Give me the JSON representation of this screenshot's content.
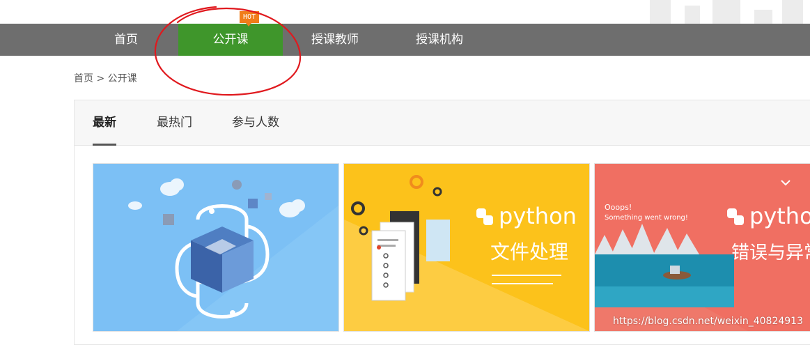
{
  "nav": {
    "items": [
      {
        "label": "首页"
      },
      {
        "label": "公开课"
      },
      {
        "label": "授课教师"
      },
      {
        "label": "授课机构"
      }
    ],
    "hot_badge": "HOT"
  },
  "breadcrumb": {
    "home": "首页",
    "separator": ">",
    "current": "公开课"
  },
  "tabs": [
    {
      "label": "最新"
    },
    {
      "label": "最热门"
    },
    {
      "label": "参与人数"
    }
  ],
  "cards": [
    {
      "theme": "python-logo"
    },
    {
      "python": "python",
      "subtitle": "文件处理"
    },
    {
      "python": "python",
      "subtitle": "错误与异常",
      "oops": "Ooops!",
      "oops_line2": "Something went wrong!"
    }
  ],
  "watermark": "https://blog.csdn.net/weixin_40824913",
  "colors": {
    "nav_bg": "#6e6e6e",
    "nav_active": "#3f962b",
    "hot_badge": "#f07d1a",
    "annotation": "#e0191e"
  }
}
